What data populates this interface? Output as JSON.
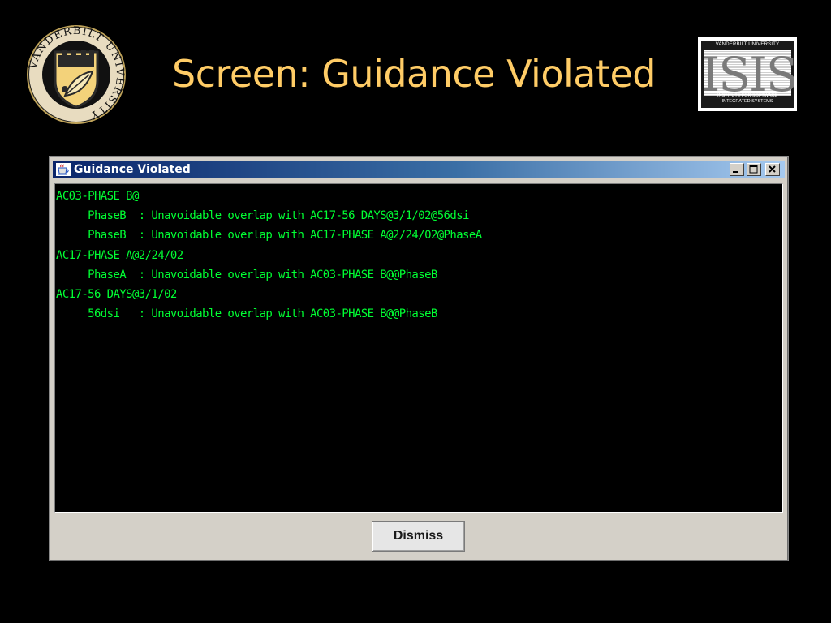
{
  "slide": {
    "title": "Screen: Guidance Violated",
    "title_color": "#FFCC66",
    "background": "#000000"
  },
  "seal": {
    "icon": "vanderbilt-university-seal-logo",
    "text": "VANDERBILT UNIVERSITY"
  },
  "isis_logo": {
    "icon": "isis-logo",
    "top_text": "VANDERBILT UNIVERSITY",
    "mark_text": "ISIS",
    "bottom_line1": "INSTITUTE FOR SOFTWARE",
    "bottom_line2": "INTEGRATED SYSTEMS"
  },
  "window": {
    "title": "Guidance Violated",
    "icon": "java-coffee-cup-icon",
    "controls": [
      "minimize",
      "maximize",
      "close"
    ],
    "console_text_color": "#00FF33",
    "lines": [
      "AC03-PHASE B@",
      "     PhaseB  : Unavoidable overlap with AC17-56 DAYS@3/1/02@56dsi",
      "     PhaseB  : Unavoidable overlap with AC17-PHASE A@2/24/02@PhaseA",
      "AC17-PHASE A@2/24/02",
      "     PhaseA  : Unavoidable overlap with AC03-PHASE B@@PhaseB",
      "AC17-56 DAYS@3/1/02",
      "     56dsi   : Unavoidable overlap with AC03-PHASE B@@PhaseB"
    ],
    "dismiss_label": "Dismiss"
  }
}
